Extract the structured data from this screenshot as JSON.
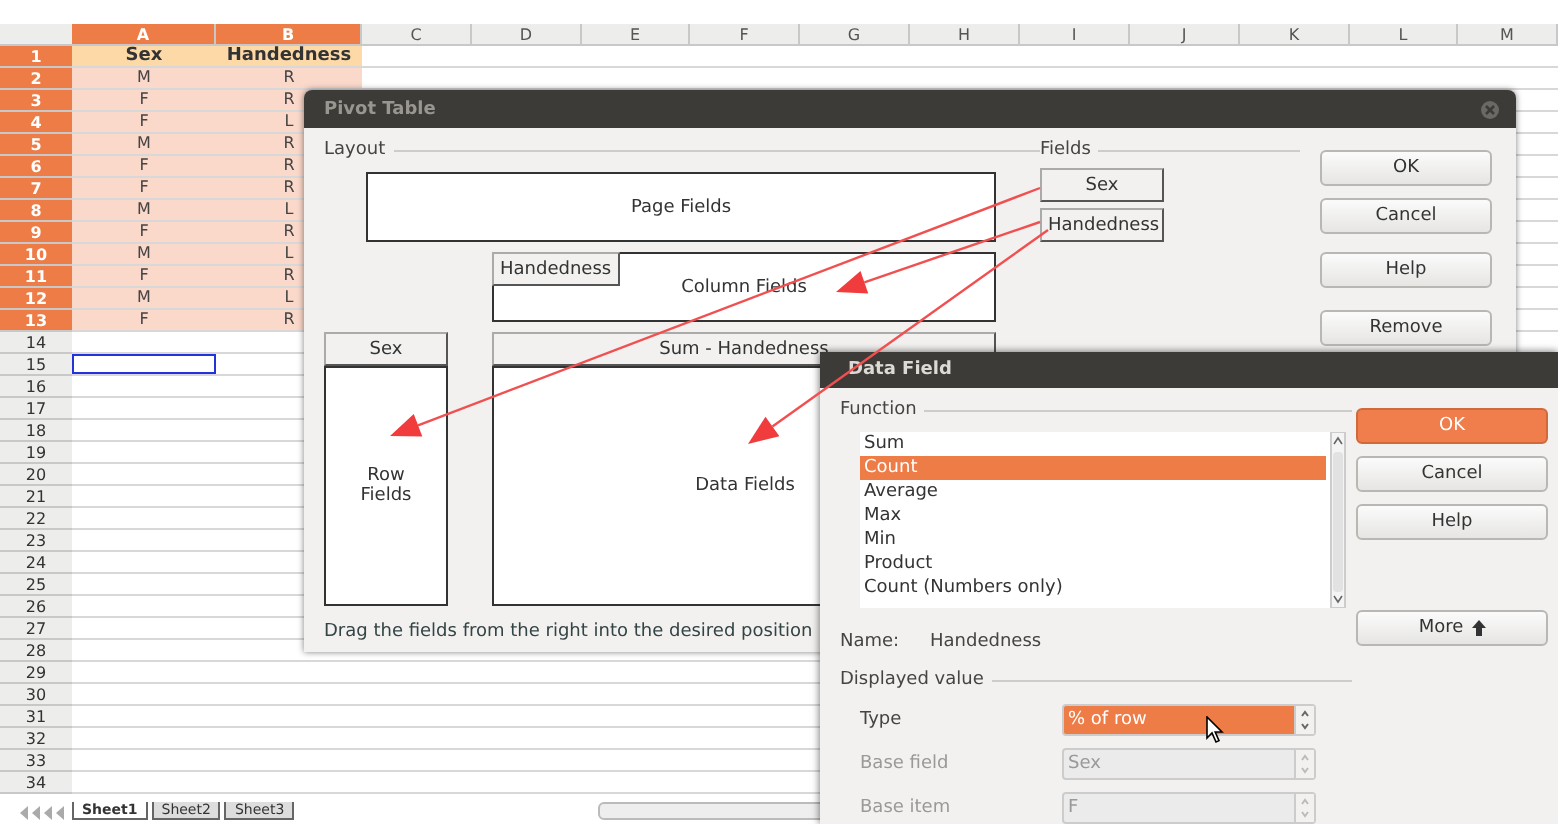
{
  "sheet": {
    "columns": [
      {
        "label": "A",
        "selected": true
      },
      {
        "label": "B",
        "selected": true
      },
      {
        "label": "C",
        "selected": false
      },
      {
        "label": "D",
        "selected": false
      },
      {
        "label": "E",
        "selected": false
      },
      {
        "label": "F",
        "selected": false
      },
      {
        "label": "G",
        "selected": false
      },
      {
        "label": "H",
        "selected": false
      },
      {
        "label": "I",
        "selected": false
      },
      {
        "label": "J",
        "selected": false
      },
      {
        "label": "K",
        "selected": false
      },
      {
        "label": "L",
        "selected": false
      },
      {
        "label": "M",
        "selected": false
      }
    ],
    "rows": [
      {
        "number": "1",
        "selected": true,
        "cursor": false,
        "kind": "header",
        "cells": [
          "Sex",
          "Handedness"
        ]
      },
      {
        "number": "2",
        "selected": true,
        "cursor": false,
        "cells": [
          "M",
          "R"
        ]
      },
      {
        "number": "3",
        "selected": true,
        "cursor": false,
        "cells": [
          "F",
          "R"
        ]
      },
      {
        "number": "4",
        "selected": true,
        "cursor": false,
        "cells": [
          "F",
          "L"
        ]
      },
      {
        "number": "5",
        "selected": true,
        "cursor": false,
        "cells": [
          "M",
          "R"
        ]
      },
      {
        "number": "6",
        "selected": true,
        "cursor": false,
        "cells": [
          "F",
          "R"
        ]
      },
      {
        "number": "7",
        "selected": true,
        "cursor": false,
        "cells": [
          "F",
          "R"
        ]
      },
      {
        "number": "8",
        "selected": true,
        "cursor": false,
        "cells": [
          "M",
          "L"
        ]
      },
      {
        "number": "9",
        "selected": true,
        "cursor": false,
        "cells": [
          "F",
          "R"
        ]
      },
      {
        "number": "10",
        "selected": true,
        "cursor": false,
        "cells": [
          "M",
          "L"
        ]
      },
      {
        "number": "11",
        "selected": true,
        "cursor": false,
        "cells": [
          "F",
          "R"
        ]
      },
      {
        "number": "12",
        "selected": true,
        "cursor": false,
        "cells": [
          "M",
          "L"
        ]
      },
      {
        "number": "13",
        "selected": true,
        "cursor": false,
        "cells": [
          "F",
          "R"
        ]
      },
      {
        "number": "14",
        "selected": false,
        "cursor": false
      },
      {
        "number": "15",
        "selected": false,
        "cursor": true
      },
      {
        "number": "16",
        "selected": false,
        "cursor": false
      },
      {
        "number": "17",
        "selected": false,
        "cursor": false
      },
      {
        "number": "18",
        "selected": false,
        "cursor": false
      },
      {
        "number": "19",
        "selected": false,
        "cursor": false
      },
      {
        "number": "20",
        "selected": false,
        "cursor": false
      },
      {
        "number": "21",
        "selected": false,
        "cursor": false
      },
      {
        "number": "22",
        "selected": false,
        "cursor": false
      },
      {
        "number": "23",
        "selected": false,
        "cursor": false
      },
      {
        "number": "24",
        "selected": false,
        "cursor": false
      },
      {
        "number": "25",
        "selected": false,
        "cursor": false
      },
      {
        "number": "26",
        "selected": false,
        "cursor": false
      },
      {
        "number": "27",
        "selected": false,
        "cursor": false
      },
      {
        "number": "28",
        "selected": false,
        "cursor": false
      },
      {
        "number": "29",
        "selected": false,
        "cursor": false
      },
      {
        "number": "30",
        "selected": false,
        "cursor": false
      },
      {
        "number": "31",
        "selected": false,
        "cursor": false
      },
      {
        "number": "32",
        "selected": false,
        "cursor": false
      },
      {
        "number": "33",
        "selected": false,
        "cursor": false
      },
      {
        "number": "34",
        "selected": false,
        "cursor": false
      }
    ],
    "tabs": [
      {
        "label": "Sheet1",
        "selected": true
      },
      {
        "label": "Sheet2",
        "selected": false
      },
      {
        "label": "Sheet3",
        "selected": false
      }
    ]
  },
  "pivot_dialog": {
    "title": "Pivot Table",
    "layout_label": "Layout",
    "page_fields": "Page Fields",
    "column_field_buttons": [
      "Handedness"
    ],
    "column_fields": "Column Fields",
    "row_field_buttons": [
      "Sex"
    ],
    "row_fields": "Row Fields",
    "data_field_buttons": [
      "Sum - Handedness"
    ],
    "data_fields": "Data Fields",
    "fields_label": "Fields",
    "fields": [
      "Sex",
      "Handedness"
    ],
    "buttons": [
      "OK",
      "Cancel",
      "Help",
      "Remove"
    ],
    "hint": "Drag the fields from the right into the desired position"
  },
  "data_field_dialog": {
    "title": "Data Field",
    "function_label": "Function",
    "functions": [
      {
        "label": "Sum",
        "selected": false
      },
      {
        "label": "Count",
        "selected": true
      },
      {
        "label": "Average",
        "selected": false
      },
      {
        "label": "Max",
        "selected": false
      },
      {
        "label": "Min",
        "selected": false
      },
      {
        "label": "Product",
        "selected": false
      },
      {
        "label": "Count (Numbers only)",
        "selected": false
      }
    ],
    "name_label": "Name:",
    "name_value": "Handedness",
    "displayed_value_label": "Displayed value",
    "settings": [
      {
        "label": "Type",
        "value": "% of row",
        "selected": true,
        "disabled": false
      },
      {
        "label": "Base field",
        "value": "Sex",
        "selected": false,
        "disabled": true
      },
      {
        "label": "Base item",
        "value": "F",
        "selected": false,
        "disabled": true
      }
    ],
    "buttons": [
      {
        "label": "OK",
        "kind": "default"
      },
      {
        "label": "Cancel",
        "kind": "plain"
      },
      {
        "label": "Help",
        "kind": "plain"
      },
      {
        "label": "More",
        "kind": "more"
      }
    ]
  }
}
